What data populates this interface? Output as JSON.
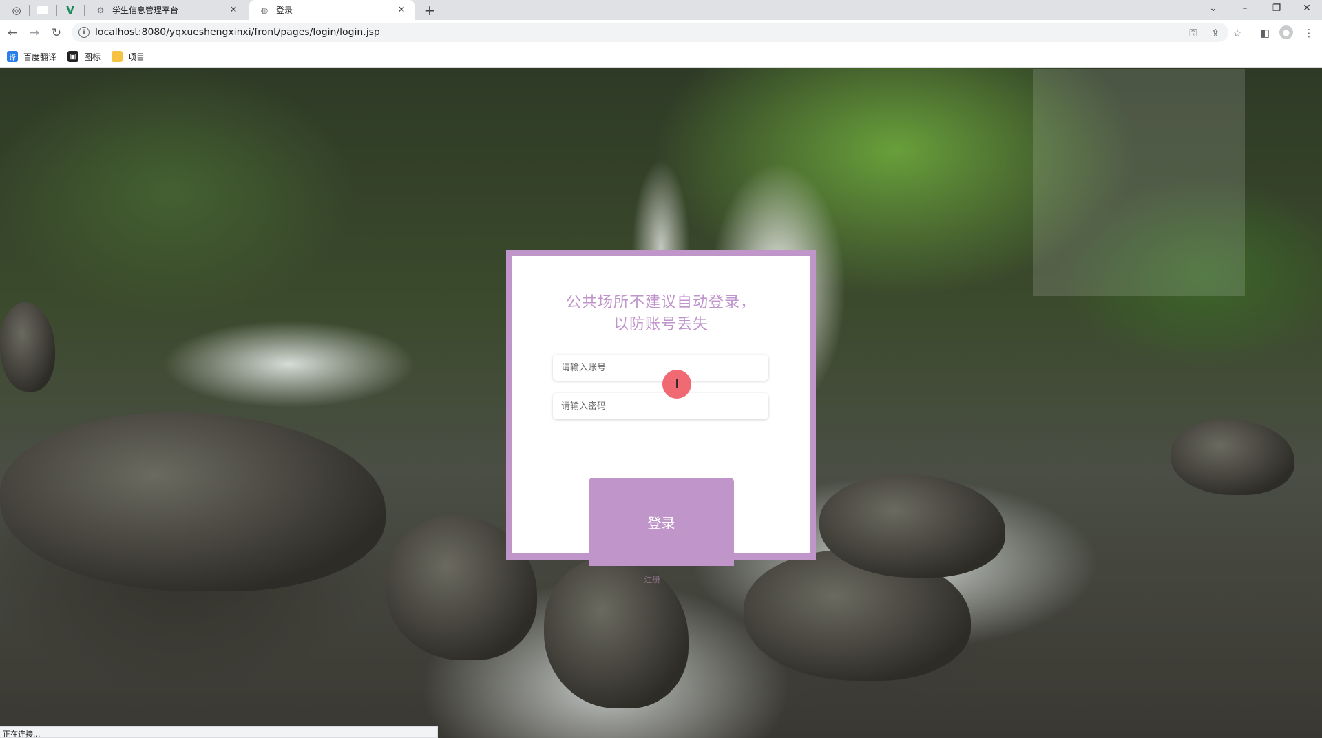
{
  "browser": {
    "tabs": [
      {
        "title": "学生信息管理平台",
        "active": false
      },
      {
        "title": "登录",
        "active": true
      }
    ],
    "url": "localhost:8080/yqxueshengxinxi/front/pages/login/login.jsp",
    "bookmarks": [
      "百度翻译",
      "图标",
      "项目"
    ],
    "status_text": "正在连接..."
  },
  "login": {
    "title_line1": "公共场所不建议自动登录，",
    "title_line2": "以防账号丢失",
    "username_placeholder": "请输入账号",
    "password_placeholder": "请输入密码",
    "login_button": "登录",
    "register_link": "注册"
  },
  "colors": {
    "accent": "#c095ca"
  }
}
